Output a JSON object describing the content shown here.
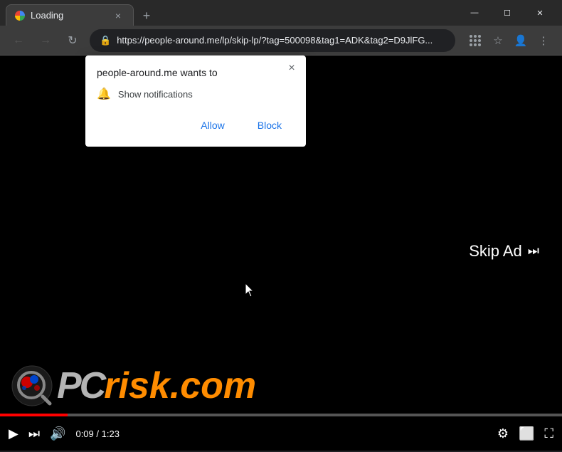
{
  "browser": {
    "tab": {
      "title": "Loading",
      "favicon_label": "chrome-favicon"
    },
    "window_controls": {
      "minimize": "—",
      "maximize": "☐",
      "close": "✕"
    },
    "nav": {
      "back": "←",
      "forward": "→",
      "refresh": "↻"
    },
    "url": "https://people-around.me/lp/skip-lp/?tag=500098&tag1=ADK&tag2=D9JlFG...",
    "url_short": "https://people-around.me/lp/skip-lp/?tag=500098&tag1=ADK&tag2=D9JlFG..."
  },
  "popup": {
    "title": "people-around.me wants to",
    "permission": "Show notifications",
    "close_label": "×",
    "allow_label": "Allow",
    "block_label": "Block"
  },
  "video": {
    "skip_ad_label": "Skip Ad",
    "watermark_pc": "PC",
    "watermark_risk": "risk",
    "watermark_dot": ".",
    "watermark_com": "com",
    "time_current": "0:09",
    "time_total": "1:23",
    "time_separator": " / "
  },
  "controls": {
    "play": "▶",
    "next": "⏭",
    "volume": "🔊",
    "settings": "⚙",
    "miniplayer": "⬜",
    "fullscreen": "⛶"
  }
}
